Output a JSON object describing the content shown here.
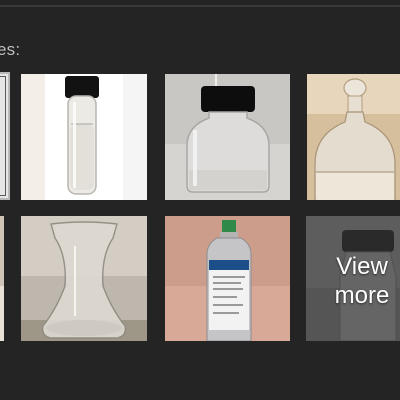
{
  "section": {
    "label": "es:"
  },
  "thumbnails": [
    {
      "name": "vial-black-cap"
    },
    {
      "name": "round-bottle-black-cap"
    },
    {
      "name": "glass-stopper-bottle"
    },
    {
      "name": "glass-beaker"
    },
    {
      "name": "aluminum-canister"
    }
  ],
  "view_more": {
    "label_line1": "View",
    "label_line2": "more"
  }
}
